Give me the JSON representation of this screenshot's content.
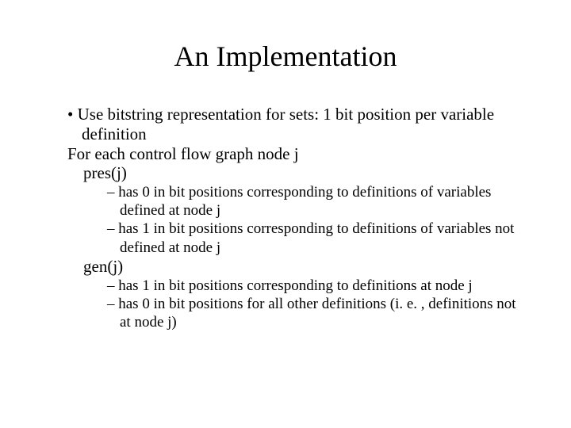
{
  "title": "An Implementation",
  "b1": "Use bitstring representation for sets: 1 bit position per variable definition",
  "l1": "For each control flow graph node j",
  "pres": "pres(j)",
  "pres_s1": "has 0 in bit positions corresponding to definitions of variables defined at node j",
  "pres_s2": "has 1 in bit positions corresponding to definitions of variables not defined at node j",
  "gen": "gen(j)",
  "gen_s1": "has 1 in bit positions corresponding to definitions at node j",
  "gen_s2": "has 0 in bit positions for all other definitions (i. e. , definitions not at node j)"
}
